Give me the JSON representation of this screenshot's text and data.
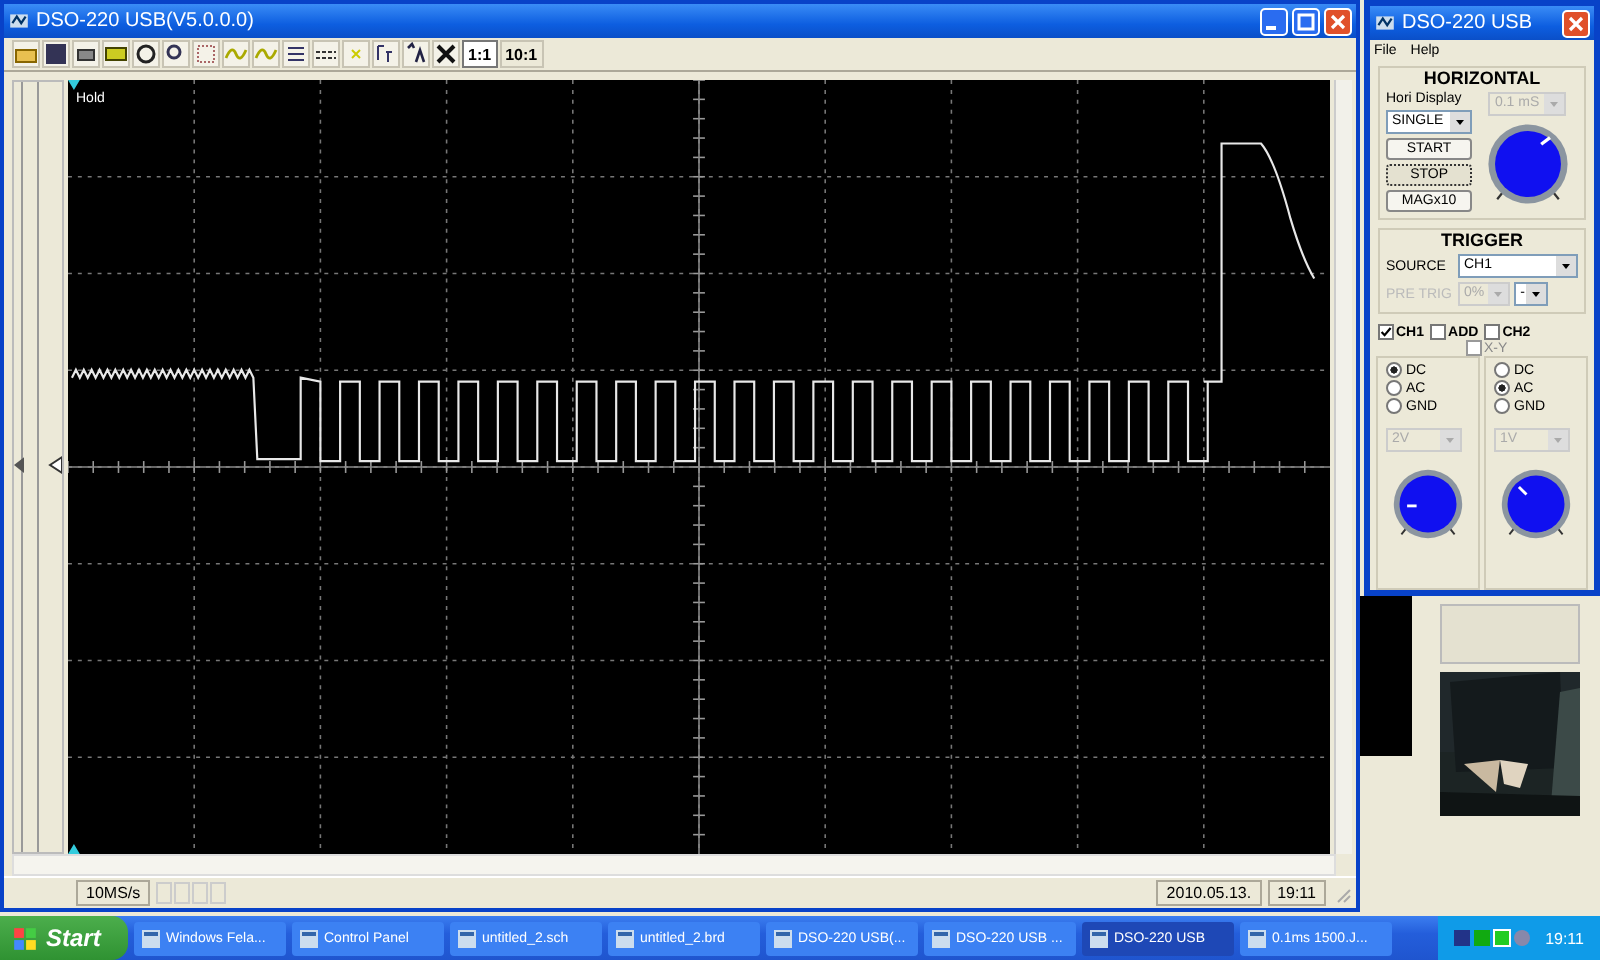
{
  "main_window": {
    "title": "DSO-220 USB(V5.0.0.0)",
    "ratio_buttons": [
      {
        "label": "1:1",
        "selected": true
      },
      {
        "label": "10:1",
        "selected": false
      }
    ],
    "screen_label": "Hold",
    "status_bar": {
      "sample_rate": "10MS/s",
      "date": "2010.05.13.",
      "time": "19:11"
    }
  },
  "control_window": {
    "title": "DSO-220 USB",
    "menu": [
      "File",
      "Help"
    ],
    "horizontal": {
      "heading": "HORIZONTAL",
      "hori_display_label": "Hori Display",
      "mode": "SINGLE",
      "timebase": "0.1 mS",
      "timebase_disabled": true,
      "buttons": [
        {
          "label": "START",
          "pressed": false
        },
        {
          "label": "STOP",
          "pressed": true
        },
        {
          "label": "MAGx10",
          "pressed": false
        }
      ]
    },
    "trigger": {
      "heading": "TRIGGER",
      "source_label": "SOURCE",
      "source": "CH1",
      "pre_trig_label": "PRE TRIG",
      "pre_trig": "0%",
      "pre_trig_unit": "-",
      "pre_trig_disabled": true
    },
    "channel_checks": [
      {
        "label": "CH1",
        "checked": true
      },
      {
        "label": "ADD",
        "checked": false
      },
      {
        "label": "CH2",
        "checked": false
      }
    ],
    "xy": {
      "label": "X-Y",
      "checked": false
    },
    "channels": [
      {
        "coupling": [
          {
            "label": "DC",
            "selected": true
          },
          {
            "label": "AC",
            "selected": false
          },
          {
            "label": "GND",
            "selected": false
          }
        ],
        "volts": "2V",
        "volts_disabled": true
      },
      {
        "coupling": [
          {
            "label": "DC",
            "selected": false
          },
          {
            "label": "AC",
            "selected": true
          },
          {
            "label": "GND",
            "selected": false
          }
        ],
        "volts": "1V",
        "volts_disabled": true
      }
    ]
  },
  "taskbar": {
    "start": "Start",
    "items": [
      {
        "label": "Windows Fela...",
        "selected": false
      },
      {
        "label": "Control Panel",
        "selected": false
      },
      {
        "label": "untitled_2.sch",
        "selected": false
      },
      {
        "label": "untitled_2.brd",
        "selected": false
      },
      {
        "label": "DSO-220 USB(...",
        "selected": false
      },
      {
        "label": "DSO-220 USB ...",
        "selected": false
      },
      {
        "label": "DSO-220 USB",
        "selected": true
      },
      {
        "label": "0.1ms 1500.J...",
        "selected": false
      }
    ],
    "clock": "19:11"
  }
}
